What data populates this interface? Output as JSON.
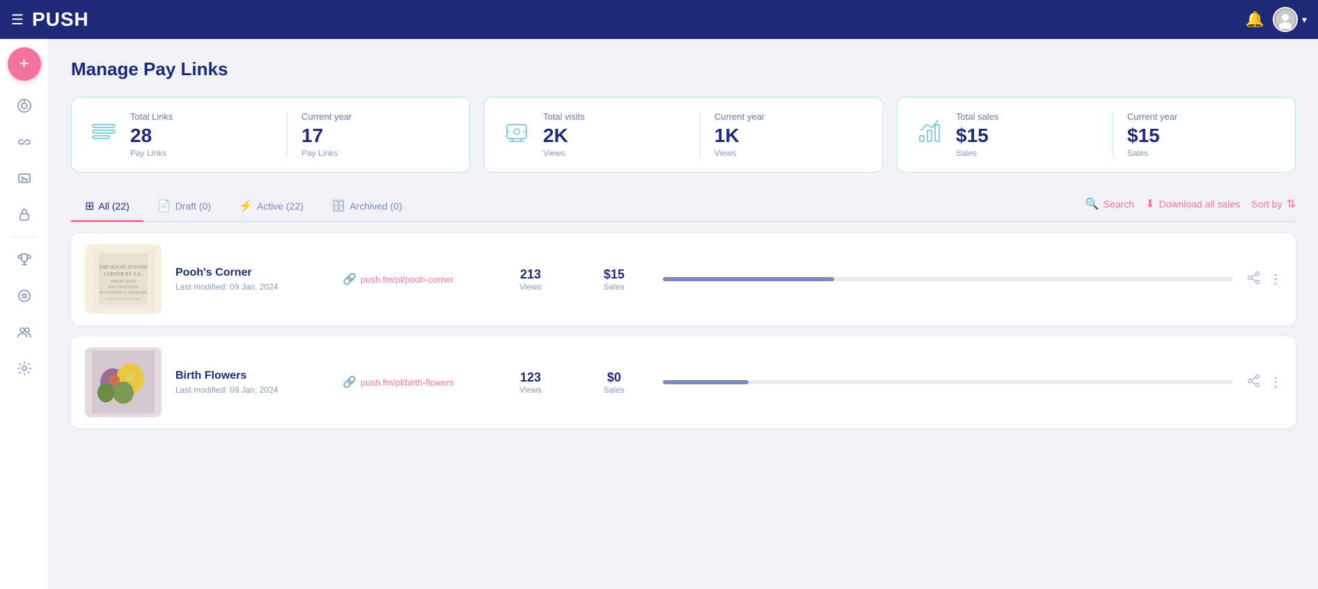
{
  "app": {
    "name": "PUSH",
    "page_title": "Manage Pay Links"
  },
  "topnav": {
    "menu_icon": "☰",
    "bell_icon": "🔔",
    "chevron": "▾"
  },
  "sidebar": {
    "add_label": "+",
    "items": [
      {
        "name": "dashboard",
        "icon": "◎"
      },
      {
        "name": "links",
        "icon": "🔗"
      },
      {
        "name": "media",
        "icon": "⬜"
      },
      {
        "name": "lock",
        "icon": "🔒"
      },
      {
        "name": "trophy",
        "icon": "🏆"
      },
      {
        "name": "vinyl",
        "icon": "◉"
      },
      {
        "name": "team",
        "icon": "👥"
      },
      {
        "name": "settings",
        "icon": "⚙"
      }
    ]
  },
  "stats": [
    {
      "icon": "≡",
      "sections": [
        {
          "label": "Total Links",
          "value": "28",
          "sub": "Pay Links"
        },
        {
          "label": "Current year",
          "value": "17",
          "sub": "Pay Links"
        }
      ]
    },
    {
      "icon": "🖥",
      "sections": [
        {
          "label": "Total visits",
          "value": "2K",
          "sub": "Views"
        },
        {
          "label": "Current year",
          "value": "1K",
          "sub": "Views"
        }
      ]
    },
    {
      "icon": "📊",
      "sections": [
        {
          "label": "Total sales",
          "value": "$15",
          "sub": "Sales"
        },
        {
          "label": "Current year",
          "value": "$15",
          "sub": "Sales"
        }
      ]
    }
  ],
  "tabs": [
    {
      "label": "All (22)",
      "icon": "⊞",
      "active": true
    },
    {
      "label": "Draft (0)",
      "icon": "📄",
      "active": false
    },
    {
      "label": "Active (22)",
      "icon": "⚡",
      "active": false
    },
    {
      "label": "Archived (0)",
      "icon": "🗄",
      "active": false
    }
  ],
  "tab_actions": {
    "search_label": "Search",
    "download_label": "Download all sales",
    "sort_label": "Sort by"
  },
  "items": [
    {
      "name": "Pooh's Corner",
      "date": "Last modified: 09 Jan, 2024",
      "link": "push.fm/pl/pooh-corner",
      "views": "213",
      "views_label": "Views",
      "sales": "$15",
      "sales_label": "Sales",
      "progress": 30
    },
    {
      "name": "Birth Flowers",
      "date": "Last modified: 09 Jan, 2024",
      "link": "push.fm/pl/birth-flowers",
      "views": "123",
      "views_label": "Views",
      "sales": "$0",
      "sales_label": "Sales",
      "progress": 15
    }
  ]
}
